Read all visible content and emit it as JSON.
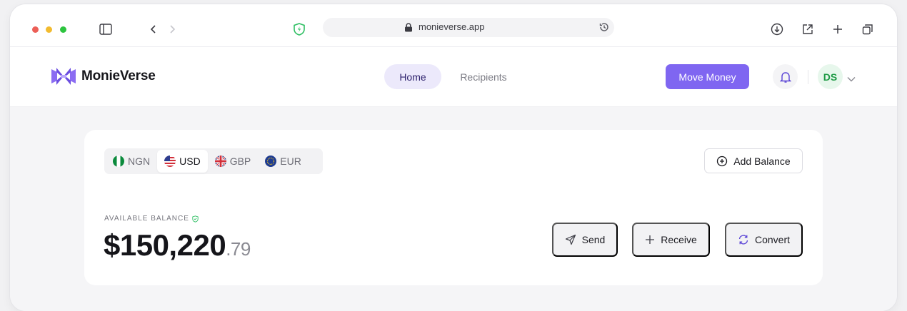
{
  "browser": {
    "url": "monieverse.app"
  },
  "header": {
    "brand": "MonieVerse",
    "nav": [
      {
        "label": "Home",
        "active": true
      },
      {
        "label": "Recipients",
        "active": false
      }
    ],
    "cta": "Move Money",
    "user_initials": "DS"
  },
  "wallet": {
    "currencies": [
      {
        "code": "NGN",
        "icon": "nigeria-flag-icon",
        "active": false
      },
      {
        "code": "USD",
        "icon": "us-flag-icon",
        "active": true
      },
      {
        "code": "GBP",
        "icon": "uk-flag-icon",
        "active": false
      },
      {
        "code": "EUR",
        "icon": "eu-flag-icon",
        "active": false
      }
    ],
    "add_balance_label": "Add Balance",
    "balance_label": "AVAILABLE BALANCE",
    "balance_main": "$150,220",
    "balance_cents": ".79",
    "actions": [
      {
        "label": "Send",
        "icon": "send-icon"
      },
      {
        "label": "Receive",
        "icon": "plus-icon"
      },
      {
        "label": "Convert",
        "icon": "refresh-icon"
      }
    ]
  },
  "colors": {
    "accent": "#7f66f1",
    "nav_active_bg": "#ece9fb",
    "avatar_bg": "#e7f7ec",
    "avatar_text": "#1e9a45"
  }
}
